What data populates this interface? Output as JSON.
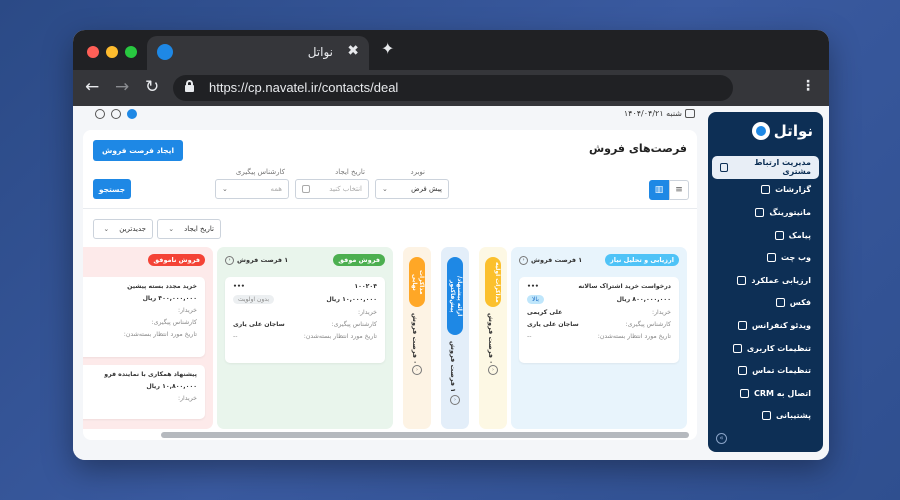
{
  "browser": {
    "tab_title": "نواتل",
    "tab_close": "✖",
    "tab_new": "✦",
    "back": "←",
    "forward": "→",
    "reload": "↻",
    "url": "https://cp.navatel.ir/contacts/deal",
    "menu": "⋮"
  },
  "topbar": {
    "date": "شنبه ۱۴۰۴/۰۴/۲۱"
  },
  "sidebar": {
    "logo": "نواتل",
    "collapse": "»",
    "items": [
      {
        "label": "مدیریت ارتباط مشتری",
        "icon": "users-icon",
        "active": true
      },
      {
        "label": "گزارشات",
        "icon": "report-icon"
      },
      {
        "label": "مانیتورینگ",
        "icon": "monitor-icon"
      },
      {
        "label": "پیامک",
        "icon": "send-icon"
      },
      {
        "label": "وب چت",
        "icon": "chat-icon"
      },
      {
        "label": "ارزیابی عملکرد",
        "icon": "clipboard-icon"
      },
      {
        "label": "فکس",
        "icon": "fax-icon"
      },
      {
        "label": "ویدئو کنفرانس",
        "icon": "video-icon"
      },
      {
        "label": "تنظیمات کاربری",
        "icon": "user-settings-icon"
      },
      {
        "label": "تنظیمات تماس",
        "icon": "phone-settings-icon"
      },
      {
        "label": "اتصال به CRM",
        "icon": "link-icon"
      },
      {
        "label": "پشتیبانی",
        "icon": "support-icon"
      }
    ]
  },
  "main": {
    "title": "فرصت‌های فروش",
    "create_button": "ایجاد فرصت فروش",
    "filters": {
      "stage_label": "نوبرد",
      "stage_value": "پیش فرض",
      "date_label": "تاریخ ایجاد",
      "date_placeholder": "انتخاب کنید",
      "expert_label": "کارشناس پیگیری",
      "expert_value": "همه",
      "search_button": "جستجو"
    },
    "sort": {
      "by": "تاریخ ایجاد",
      "order": "جدیدترین"
    }
  },
  "board": {
    "columns": [
      {
        "badge": "ارزیابی و تحلیل نیاز",
        "count": "۱ فرصت فروش",
        "cards": [
          {
            "title": "درخواست خرید اشتراک سالانه",
            "amount": "۸۰۰,۰۰۰,۰۰۰ ریال",
            "priority": "بالا",
            "buyer_label": "خریدار:",
            "buyer": "علی کریمی",
            "expert_label": "کارشناس پیگیری:",
            "expert": "ساجان علی یاری",
            "close_label": "تاریخ مورد انتظار بسته‌شدن:",
            "close": "--"
          }
        ]
      },
      {
        "badge": "مذاکرات اولیه",
        "count": "۰ فرصت فروش"
      },
      {
        "badge": "ارائه پیشنهاد/پیش‌فاکتور",
        "count": "۱ فرصت فروش"
      },
      {
        "badge": "مذاکرات نهایی",
        "count": "۰ فرصت فروش"
      },
      {
        "badge": "فروش موفق",
        "count": "۱ فرصت فروش",
        "cards": [
          {
            "title": "۱۰۰۲۰۴",
            "amount": "۱۰,۰۰۰,۰۰۰ ریال",
            "priority": "بدون اولویت",
            "buyer_label": "خریدار:",
            "buyer": "",
            "expert_label": "کارشناس پیگیری:",
            "expert": "ساجان علی یاری",
            "close_label": "تاریخ مورد انتظار بسته‌شدن:",
            "close": "--"
          }
        ]
      },
      {
        "badge": "فروش ناموفق",
        "cards": [
          {
            "title": "خرید مجدد بسته پیشین",
            "amount": "۴۰۰,۰۰۰,۰۰۰ ریال",
            "buyer_label": "خریدار:",
            "expert_label": "کارشناس پیگیری:",
            "close_label": "تاریخ مورد انتظار بسته‌شدن:"
          },
          {
            "title": "پیشنهاد همکاری با نماینده فرو",
            "amount": "۱۰,۸۰۰,۰۰۰ ریال",
            "buyer_label": "خریدار:"
          }
        ]
      }
    ]
  },
  "colors": {
    "primary": "#1e88e5",
    "sidebar": "#0d2f55",
    "stage_analysis": "#4fc3f7",
    "stage_initial": "#fbc02d",
    "stage_proposal": "#1e88e5",
    "stage_final": "#ffa726",
    "won": "#4caf50",
    "lost": "#f44336"
  }
}
